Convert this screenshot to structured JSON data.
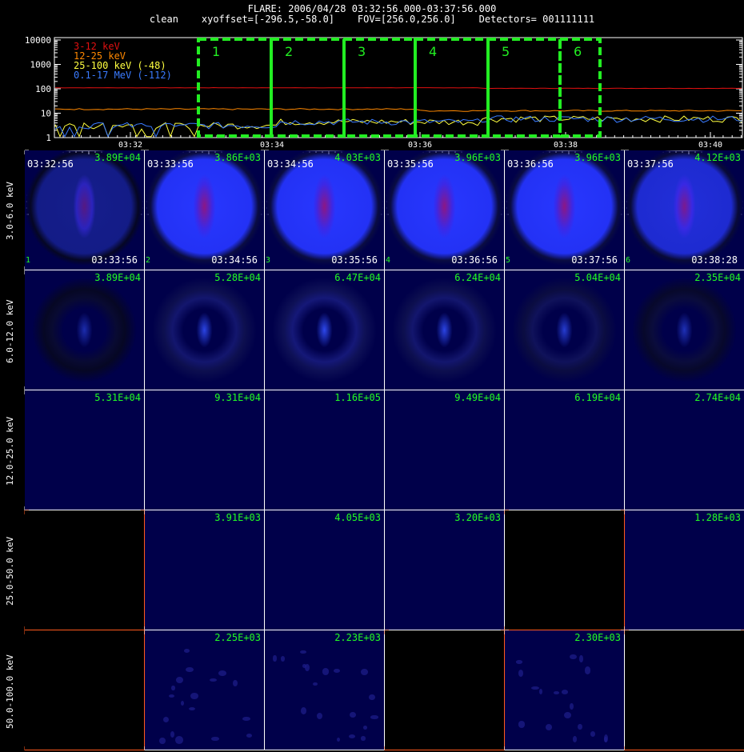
{
  "header": {
    "title": "FLARE: 2006/04/28 03:32:56.000-03:37:56.000",
    "subtitle": "clean    xyoffset=[-296.5,-58.0]    FOV=[256.0,256.0]    Detectors= 001111111"
  },
  "chart_data": [
    {
      "type": "line",
      "yscale": "log",
      "ylim": [
        1,
        10000
      ],
      "yticks": [
        "1",
        "10",
        "100",
        "1000",
        "10000"
      ],
      "xticks": [
        "03:32",
        "03:34",
        "03:36",
        "03:38",
        "03:40"
      ],
      "series": [
        {
          "name": "3-12 keV",
          "color": "#e01010",
          "level": 110
        },
        {
          "name": "12-25 keV",
          "color": "#ff8800",
          "level": 14
        },
        {
          "name": "25-100 keV (-48)",
          "color": "#ffff40",
          "level": 5
        },
        {
          "name": "0.1-17 MeV (-112)",
          "color": "#3a7bff",
          "level": 5
        }
      ],
      "intervals": [
        "1",
        "2",
        "3",
        "4",
        "5",
        "6"
      ],
      "interval_color": "#22ee22"
    },
    {
      "type": "heatmap",
      "rows": [
        "3.0-6.0 keV",
        "6.0-12.0 keV",
        "12.0-25.0 keV",
        "25.0-50.0 keV",
        "50.0-100.0 keV"
      ],
      "start_times": [
        "03:32:56",
        "03:33:56",
        "03:34:56",
        "03:35:56",
        "03:36:56",
        "03:37:56"
      ],
      "end_times": [
        "03:33:56",
        "03:34:56",
        "03:35:56",
        "03:36:56",
        "03:37:56",
        "03:38:28"
      ],
      "indices": [
        "1",
        "2",
        "3",
        "4",
        "5",
        "6"
      ],
      "peaks": [
        [
          "3.89E+04",
          "3.86E+03",
          "4.03E+03",
          "3.96E+03",
          "3.96E+03",
          "4.12E+03"
        ],
        [
          "3.89E+04",
          "5.28E+04",
          "6.47E+04",
          "6.24E+04",
          "5.04E+04",
          "2.35E+04"
        ],
        [
          "5.31E+04",
          "9.31E+04",
          "1.16E+05",
          "9.49E+04",
          "6.19E+04",
          "2.74E+04"
        ],
        [
          "",
          "3.91E+03",
          "4.05E+03",
          "3.20E+03",
          "",
          "1.28E+03"
        ],
        [
          "",
          "2.25E+03",
          "2.23E+03",
          "",
          "2.30E+03",
          ""
        ]
      ],
      "empty_axis_ticks": [
        "2",
        "4",
        "6",
        "8"
      ],
      "colors": {
        "panel": "#00004a",
        "empty": "#000000",
        "axis": "#ffffff",
        "empty_axis": "#ff5a1e",
        "peak_text": "#22ff22"
      }
    }
  ]
}
